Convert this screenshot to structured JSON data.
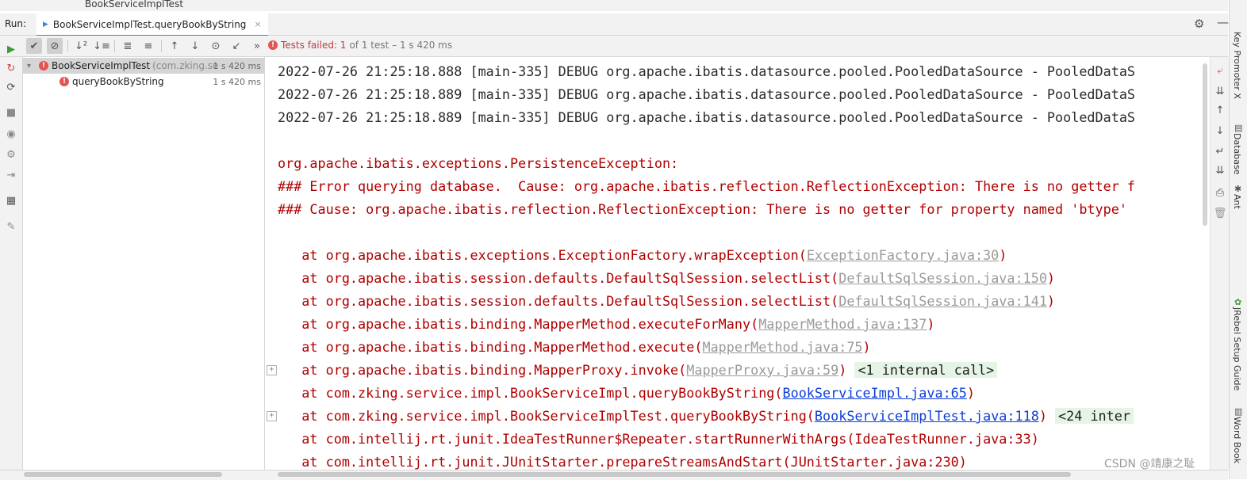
{
  "window": {
    "title": "BookServiceImplTest"
  },
  "run": {
    "label": "Run:",
    "tab_label": "BookServiceImplTest.queryBookByString",
    "close_glyph": "×"
  },
  "toolbar": {
    "overflow": "»",
    "status_failed": "Tests failed: 1",
    "status_rest": "of 1 test – 1 s 420 ms"
  },
  "tree": {
    "root": {
      "name": "BookServiceImplTest",
      "package": "(com.zking.se",
      "duration": "1 s 420 ms"
    },
    "child": {
      "name": "queryBookByString",
      "duration": "1 s 420 ms"
    }
  },
  "console": {
    "debug_lines": [
      "2022-07-26 21:25:18.888 [main-335] DEBUG org.apache.ibatis.datasource.pooled.PooledDataSource - PooledDataS",
      "2022-07-26 21:25:18.889 [main-335] DEBUG org.apache.ibatis.datasource.pooled.PooledDataSource - PooledDataS",
      "2022-07-26 21:25:18.889 [main-335] DEBUG org.apache.ibatis.datasource.pooled.PooledDataSource - PooledDataS"
    ],
    "error_lines": [
      "org.apache.ibatis.exceptions.PersistenceException: ",
      "### Error querying database.  Cause: org.apache.ibatis.reflection.ReflectionException: There is no getter f",
      "### Cause: org.apache.ibatis.reflection.ReflectionException: There is no getter for property named 'btype'"
    ],
    "stack": [
      {
        "pre": "   at org.apache.ibatis.exceptions.ExceptionFactory.wrapException(",
        "link": "ExceptionFactory.java:30",
        "post": ")"
      },
      {
        "pre": "   at org.apache.ibatis.session.defaults.DefaultSqlSession.selectList(",
        "link": "DefaultSqlSession.java:150",
        "post": ")"
      },
      {
        "pre": "   at org.apache.ibatis.session.defaults.DefaultSqlSession.selectList(",
        "link": "DefaultSqlSession.java:141",
        "post": ")"
      },
      {
        "pre": "   at org.apache.ibatis.binding.MapperMethod.executeForMany(",
        "link": "MapperMethod.java:137",
        "post": ")"
      },
      {
        "pre": "   at org.apache.ibatis.binding.MapperMethod.execute(",
        "link": "MapperMethod.java:75",
        "post": ")"
      },
      {
        "pre": "   at org.apache.ibatis.binding.MapperProxy.invoke(",
        "link": "MapperProxy.java:59",
        "post": ") ",
        "internal": "<1 internal call>"
      },
      {
        "pre": "   at com.zking.service.impl.BookServiceImpl.queryBookByString(",
        "link": "BookServiceImpl.java:65",
        "post": ")"
      },
      {
        "pre": "   at com.zking.service.impl.BookServiceImplTest.queryBookByString(",
        "link": "BookServiceImplTest.java:118",
        "post": ") ",
        "internal": "<24 inter"
      },
      {
        "pre": "   at com.intellij.rt.junit.IdeaTestRunner$Repeater.startRunnerWithArgs(IdeaTestRunner.java:33)"
      },
      {
        "pre": "   at com.intellij.rt.junit.JUnitStarter.prepareStreamsAndStart(JUnitStarter.java:230)"
      }
    ],
    "expander_glyph": "+"
  },
  "sidebar": {
    "key_promoter": "Key Promoter X",
    "database": "Database",
    "ant": "Ant",
    "jrebel": "JRebel Setup Guide",
    "word_book": "Word Book"
  },
  "watermark": "CSDN @靖康之耻",
  "colors": {
    "error": "#b00000",
    "link_blue": "#0b3ed8",
    "link_gray": "#9a9a9a",
    "internal_bg": "#e6f4e6",
    "tab_accent": "#4083c9"
  },
  "icons": {
    "tab_run": "▶",
    "play": "▶",
    "rerun_failed": "↻",
    "toggle": "⟳",
    "stop": "■",
    "camera": "◉",
    "gear_settings": "⚙",
    "login": "⇥",
    "layout": "▦",
    "pin": "✎",
    "check": "✔",
    "cancel": "⊘",
    "sort_alpha": "↓²",
    "sort_dur": "↓≡",
    "expand": "≣",
    "collapse": "≡",
    "up": "↑",
    "down": "↓",
    "history": "⊙",
    "export": "↙",
    "gear": "⚙",
    "minimize": "—",
    "chevron_down": "▾",
    "error_glyph": "!",
    "wrap": "⤶",
    "scroll_end": "⇊",
    "softwrap": "↵",
    "print": "⎙",
    "trash": "🗑",
    "sidebar_db": "▤",
    "sidebar_ant": "✱",
    "sidebar_jrebel": "✿",
    "sidebar_book": "▥"
  }
}
